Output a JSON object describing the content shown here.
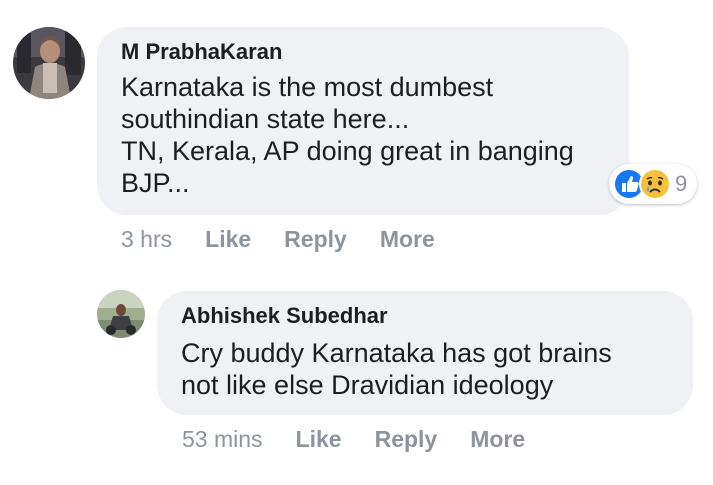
{
  "comments": [
    {
      "author": "M PrabhaKaran",
      "lines": [
        "Karnataka is the most dumbest",
        "southindian state here...",
        "TN, Kerala, AP doing great in banging",
        "BJP..."
      ],
      "time": "3 hrs",
      "like_label": "Like",
      "reply_label": "Reply",
      "more_label": "More",
      "reactions": {
        "icons": [
          "like-icon",
          "sad-icon"
        ],
        "count": "9"
      }
    },
    {
      "author": "Abhishek Subedhar",
      "lines": [
        "Cry buddy Karnataka has got brains",
        "not like else Dravidian ideology"
      ],
      "time": "53 mins",
      "like_label": "Like",
      "reply_label": "Reply",
      "more_label": "More"
    }
  ],
  "colors": {
    "bubble": "#eff1f4",
    "text": "#1c1e21",
    "meta": "#8d949e",
    "like_blue": "#1877f2",
    "sad_yellow": "#f7c03a"
  }
}
